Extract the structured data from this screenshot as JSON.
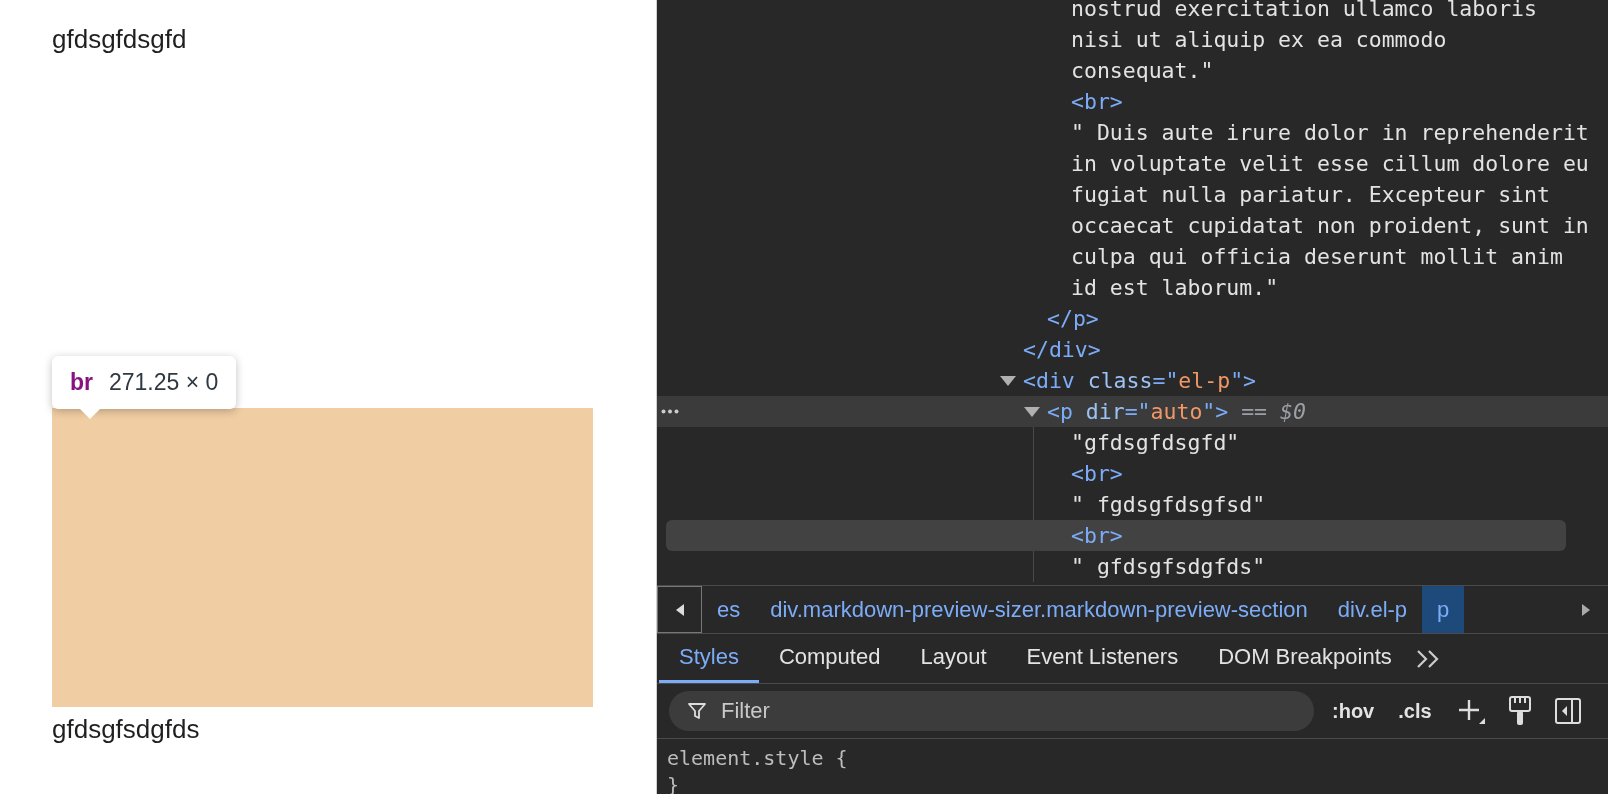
{
  "page": {
    "paragraphs": [
      {
        "text": "gfdsgfdsgfd"
      },
      {
        "text": "gfdsgfsdgfds"
      }
    ],
    "tooltip": {
      "tag": "br",
      "size": "271.25 × 0"
    }
  },
  "devtools": {
    "dom_tree": [
      {
        "kind": "element",
        "close": [
          {
            "kind": "tag",
            "text": "</div>"
          }
        ],
        "children": [
          {
            "kind": "element",
            "close": [
              {
                "kind": "tag",
                "text": "</p>"
              }
            ],
            "children": [
              {
                "kind": "text",
                "selected": false,
                "hovered": false,
                "text": "nostrud exercitation ullamco laboris nisi ut aliquip ex ea commodo consequat.\""
              },
              {
                "kind": "element",
                "selected": false,
                "hovered": false,
                "open": [
                  {
                    "kind": "tag",
                    "text": "<br>"
                  }
                ]
              },
              {
                "kind": "text",
                "selected": false,
                "hovered": false,
                "text": "\" Duis aute irure dolor in reprehenderit in voluptate velit esse cillum dolore eu fugiat nulla pariatur. Excepteur sint occaecat cupidatat non proident, sunt in culpa qui officia deserunt mollit anim id est laborum.\""
              }
            ]
          }
        ]
      },
      {
        "kind": "element",
        "expanded": true,
        "selected": false,
        "open": [
          {
            "kind": "tag",
            "text": "<div"
          },
          {
            "kind": "attr",
            "text": " class"
          },
          {
            "kind": "tag",
            "text": "=\""
          },
          {
            "kind": "value",
            "text": "el-p"
          },
          {
            "kind": "tag",
            "text": "\">"
          }
        ],
        "children": [
          {
            "kind": "element",
            "expanded": true,
            "selected": true,
            "open": [
              {
                "kind": "tag",
                "text": "<p"
              },
              {
                "kind": "attr",
                "text": " dir"
              },
              {
                "kind": "tag",
                "text": "=\""
              },
              {
                "kind": "value",
                "text": "auto"
              },
              {
                "kind": "tag",
                "text": "\">"
              },
              {
                "kind": "marker",
                "text": " == $0"
              }
            ],
            "children": [
              {
                "kind": "text",
                "selected": false,
                "hovered": false,
                "text": "\"gfdsgfdsgfd\""
              },
              {
                "kind": "element",
                "selected": false,
                "hovered": false,
                "open": [
                  {
                    "kind": "tag",
                    "text": "<br>"
                  }
                ]
              },
              {
                "kind": "text",
                "selected": false,
                "hovered": false,
                "text": "\" fgdsgfdsgfsd\""
              },
              {
                "kind": "element",
                "selected": false,
                "hovered": true,
                "open": [
                  {
                    "kind": "tag",
                    "text": "<br>"
                  }
                ]
              },
              {
                "kind": "text",
                "selected": false,
                "hovered": false,
                "text": "\" gfdsgfsdgfds\""
              }
            ]
          }
        ]
      }
    ],
    "breadcrumbs": [
      {
        "label": "es",
        "selected": false
      },
      {
        "label": "div.markdown-preview-sizer.markdown-preview-section",
        "selected": false
      },
      {
        "label": "div.el-p",
        "selected": false
      },
      {
        "label": "p",
        "selected": true
      }
    ],
    "tabs": [
      {
        "label": "Styles",
        "selected": true
      },
      {
        "label": "Computed",
        "selected": false
      },
      {
        "label": "Layout",
        "selected": false
      },
      {
        "label": "Event Listeners",
        "selected": false
      },
      {
        "label": "DOM Breakpoints",
        "selected": false
      }
    ],
    "filter": {
      "placeholder": "Filter"
    },
    "toolbar_buttons": [
      {
        "label": ":hov"
      },
      {
        "label": ".cls"
      }
    ],
    "styles": {
      "selector": "element.style {",
      "close": "}"
    }
  }
}
